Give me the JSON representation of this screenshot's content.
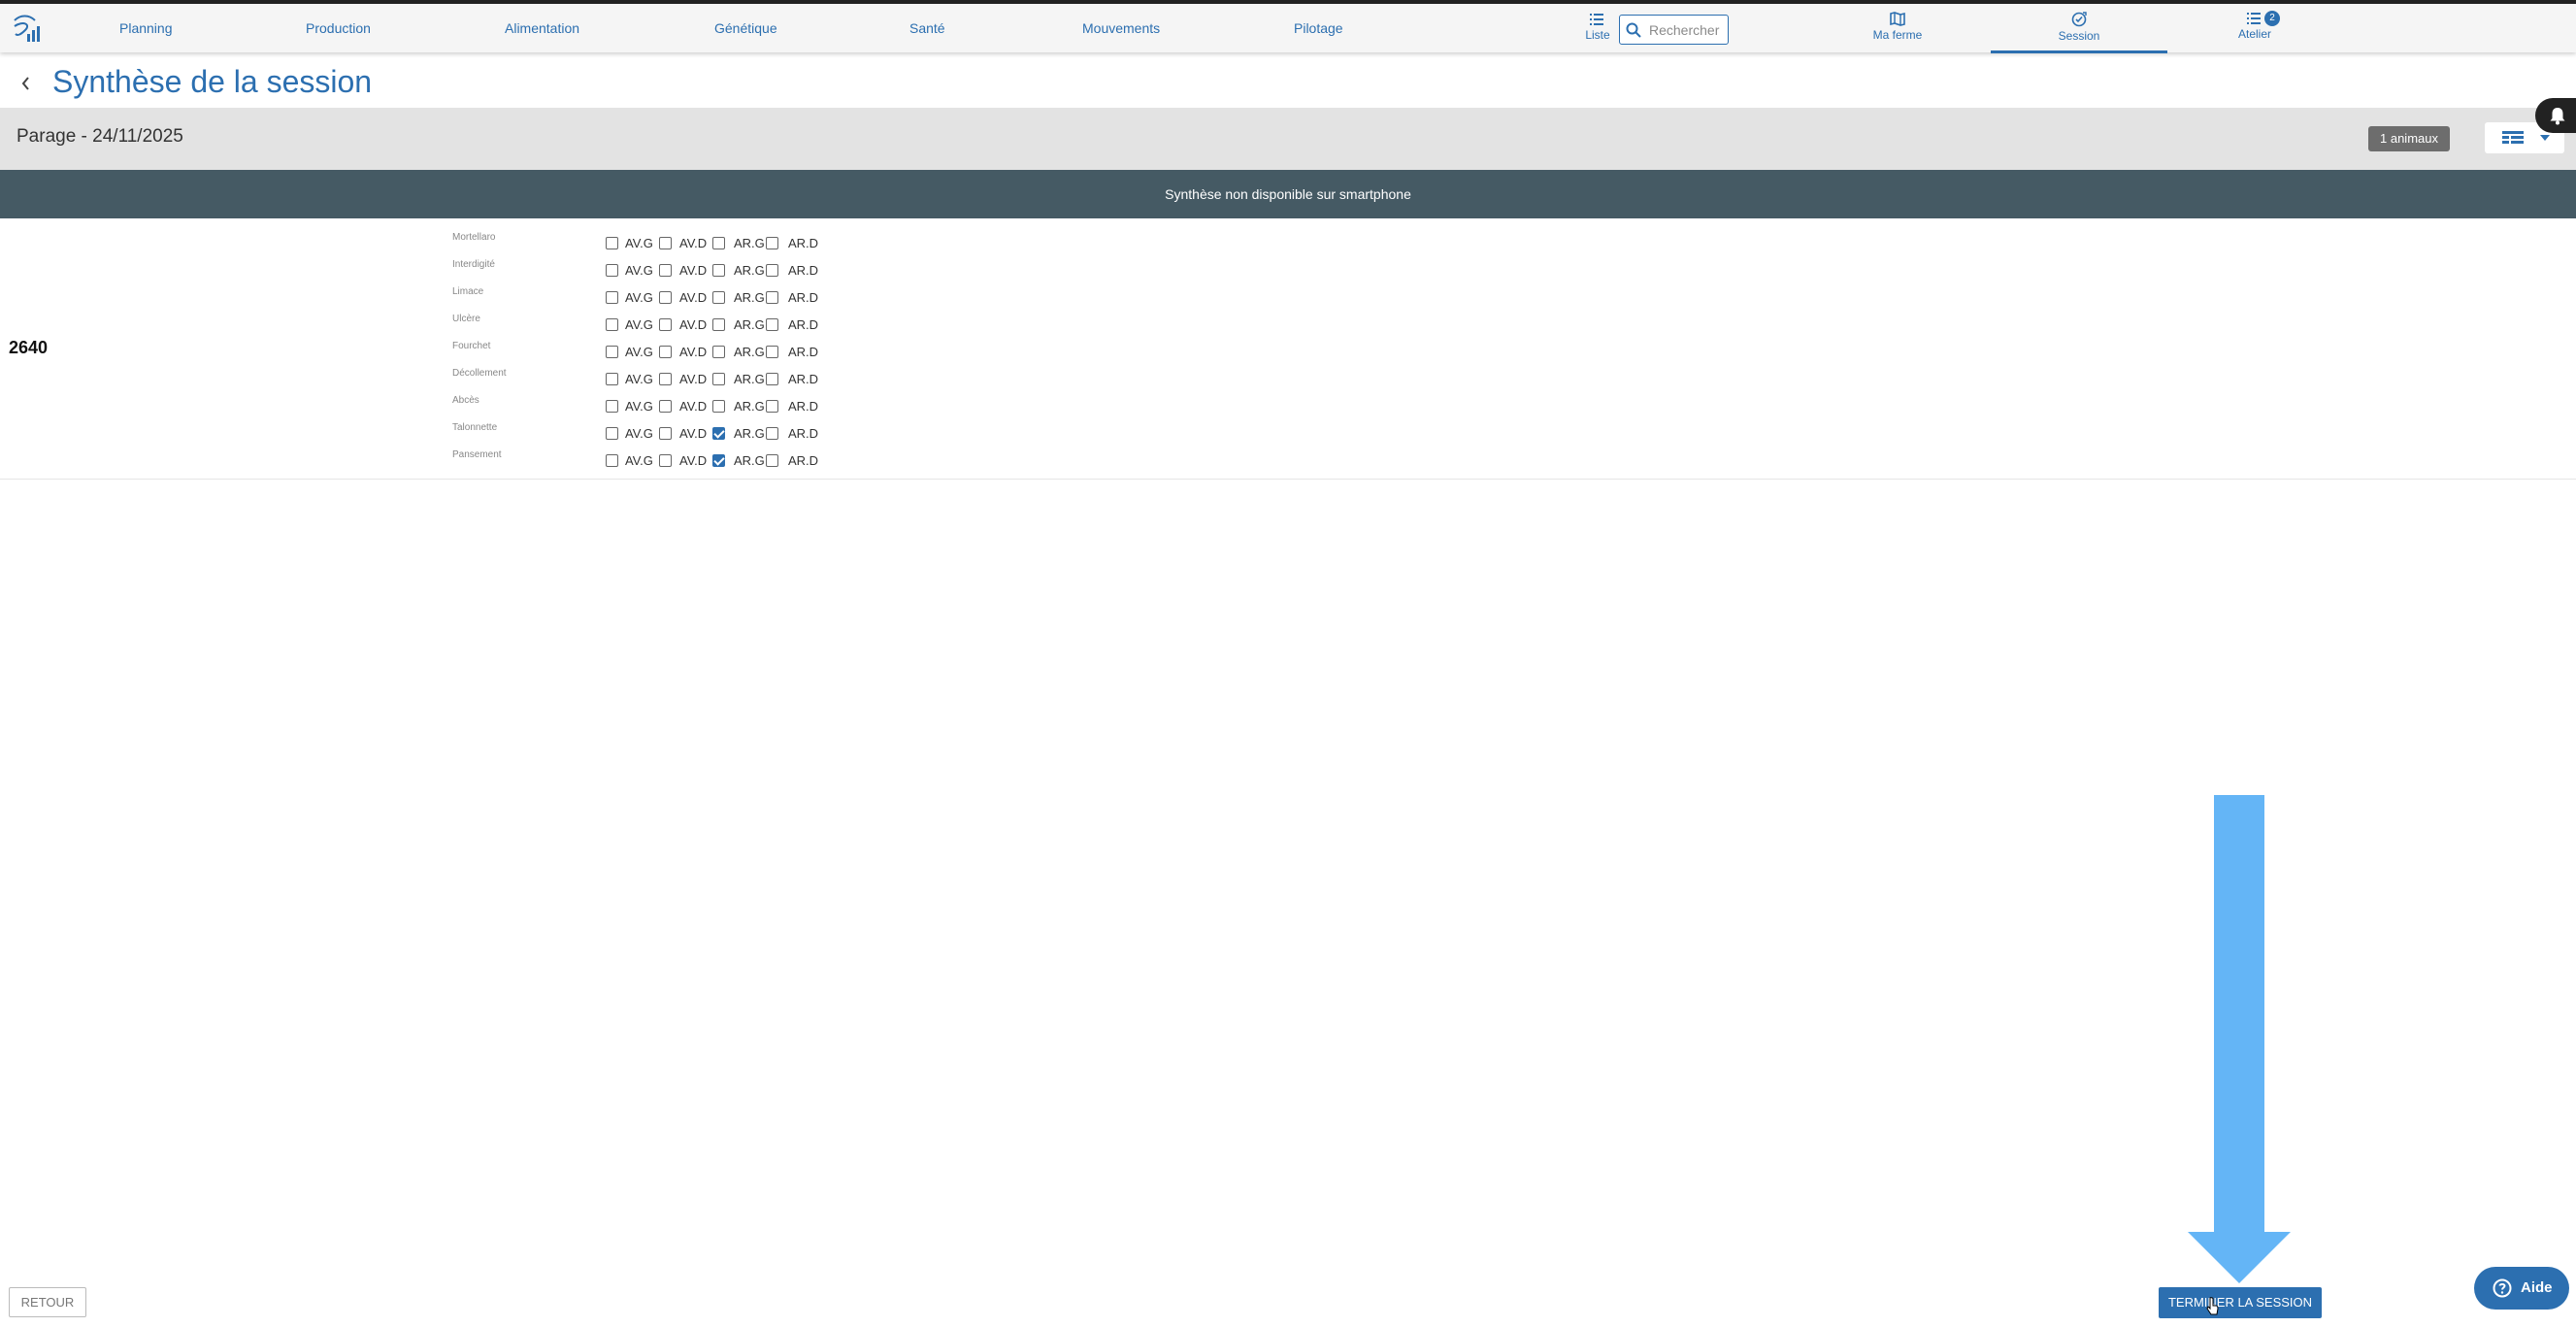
{
  "nav": {
    "items": [
      {
        "label": "Planning"
      },
      {
        "label": "Production"
      },
      {
        "label": "Alimentation"
      },
      {
        "label": "Génétique"
      },
      {
        "label": "Santé"
      },
      {
        "label": "Mouvements"
      },
      {
        "label": "Pilotage"
      }
    ],
    "liste_label": "Liste",
    "search_placeholder": "Rechercher",
    "tabs": [
      {
        "label": "Ma ferme",
        "icon": "map-icon",
        "active": false
      },
      {
        "label": "Session",
        "icon": "session-check-icon",
        "active": true
      },
      {
        "label": "Atelier",
        "icon": "list-icon",
        "active": false,
        "badge": "2"
      }
    ]
  },
  "page": {
    "title": "Synthèse de la session",
    "session_name": "Parage - 24/11/2025",
    "animal_count": "1 animaux",
    "notice": "Synthèse non disponible sur smartphone"
  },
  "animal": {
    "id": "2640",
    "columns": [
      "AV.G",
      "AV.D",
      "AR.G",
      "AR.D"
    ],
    "lesions": [
      {
        "label": "Mortellaro",
        "checked": [
          false,
          false,
          false,
          false
        ]
      },
      {
        "label": "Interdigité",
        "checked": [
          false,
          false,
          false,
          false
        ]
      },
      {
        "label": "Limace",
        "checked": [
          false,
          false,
          false,
          false
        ]
      },
      {
        "label": "Ulcère",
        "checked": [
          false,
          false,
          false,
          false
        ]
      },
      {
        "label": "Fourchet",
        "checked": [
          false,
          false,
          false,
          false
        ]
      },
      {
        "label": "Décollement",
        "checked": [
          false,
          false,
          false,
          false
        ]
      },
      {
        "label": "Abcès",
        "checked": [
          false,
          false,
          false,
          false
        ]
      },
      {
        "label": "Talonnette",
        "checked": [
          false,
          false,
          true,
          false
        ]
      },
      {
        "label": "Pansement",
        "checked": [
          false,
          false,
          true,
          false
        ]
      }
    ]
  },
  "footer": {
    "retour_label": "RETOUR",
    "terminer_label": "TERMINER LA SESSION",
    "aide_label": "Aide"
  },
  "colors": {
    "accent": "#2c6fb0",
    "notice_bg": "#455a64",
    "annotation_arrow": "#64b5f6"
  }
}
